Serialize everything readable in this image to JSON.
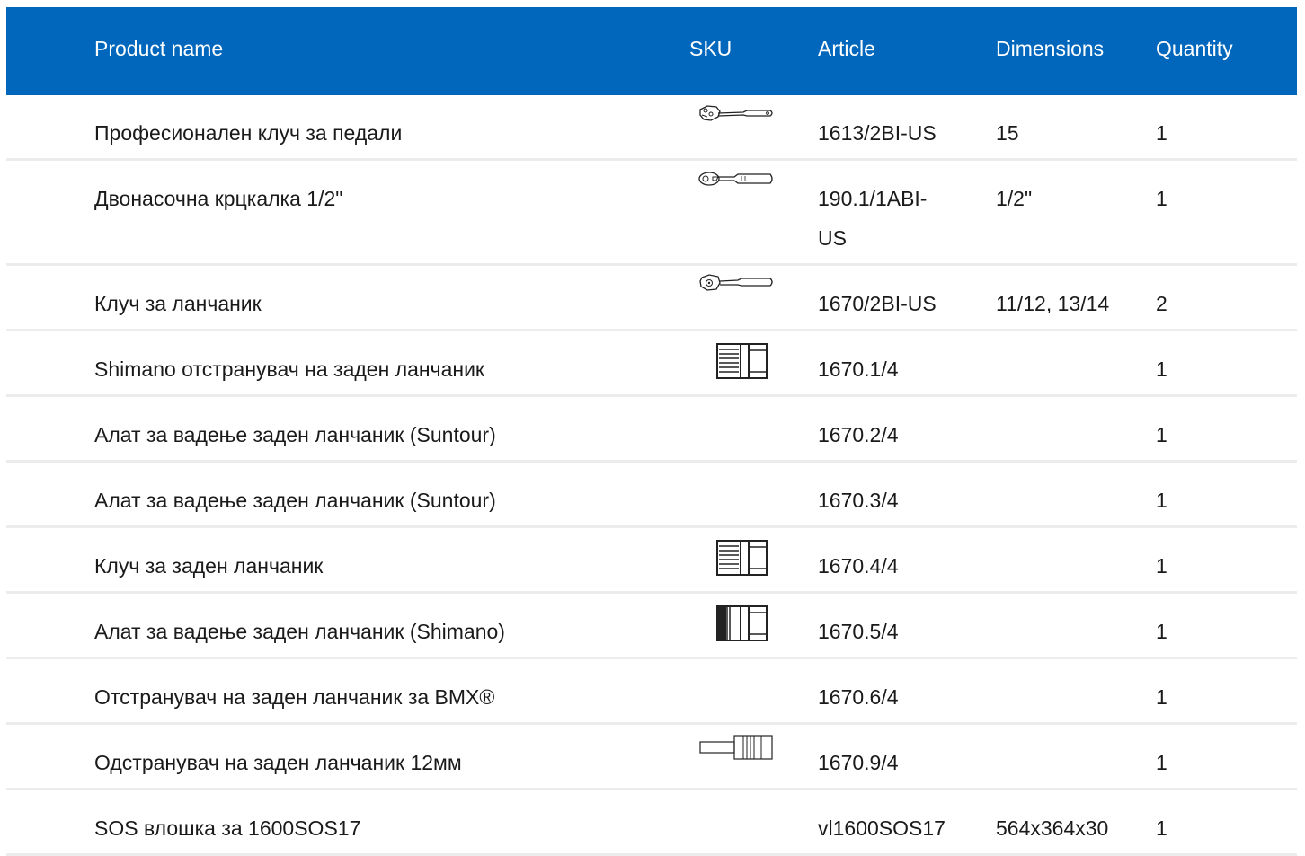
{
  "table": {
    "headers": {
      "product_name": "Product name",
      "sku": "SKU",
      "article": "Article",
      "dimensions": "Dimensions",
      "quantity": "Quantity"
    },
    "rows": [
      {
        "name": "Професионален клуч за педали",
        "sku_icon": "pedal-wrench-icon",
        "article": "1613/2BI-US",
        "dimensions": "15",
        "quantity": "1"
      },
      {
        "name": "Двонасочна крцкалка 1/2\"",
        "sku_icon": "ratchet-icon",
        "article": "190.1/1ABI-US",
        "dimensions": "1/2\"",
        "quantity": "1"
      },
      {
        "name": "Клуч за ланчаник",
        "sku_icon": "chainring-wrench-icon",
        "article": "1670/2BI-US",
        "dimensions": "11/12, 13/14",
        "quantity": "2"
      },
      {
        "name": "Shimano отстранувач на заден ланчаник",
        "sku_icon": "cassette-remover-icon",
        "article": "1670.1/4",
        "dimensions": "",
        "quantity": "1"
      },
      {
        "name": "Алат за вадење заден ланчаник (Suntour)",
        "sku_icon": "",
        "article": "1670.2/4",
        "dimensions": "",
        "quantity": "1"
      },
      {
        "name": "Алат за вадење заден ланчаник (Suntour)",
        "sku_icon": "",
        "article": "1670.3/4",
        "dimensions": "",
        "quantity": "1"
      },
      {
        "name": "Клуч за заден ланчаник",
        "sku_icon": "cassette-remover-icon",
        "article": "1670.4/4",
        "dimensions": "",
        "quantity": "1"
      },
      {
        "name": "Алат за вадење заден ланчаник (Shimano)",
        "sku_icon": "cassette-remover-dense-icon",
        "article": "1670.5/4",
        "dimensions": "",
        "quantity": "1"
      },
      {
        "name": "Отстранувач на заден ланчаник за BMX®",
        "sku_icon": "",
        "article": "1670.6/4",
        "dimensions": "",
        "quantity": "1"
      },
      {
        "name": "Одстранувач на заден ланчаник 12мм",
        "sku_icon": "freewheel-remover-icon",
        "article": "1670.9/4",
        "dimensions": "",
        "quantity": "1"
      },
      {
        "name": "SOS влошка за 1600SOS17",
        "sku_icon": "",
        "article": "vl1600SOS17",
        "dimensions": "564x364x30",
        "quantity": "1"
      }
    ]
  },
  "colors": {
    "header_bg": "#0067bd",
    "header_text": "#ffffff",
    "row_divider": "#ececec"
  }
}
